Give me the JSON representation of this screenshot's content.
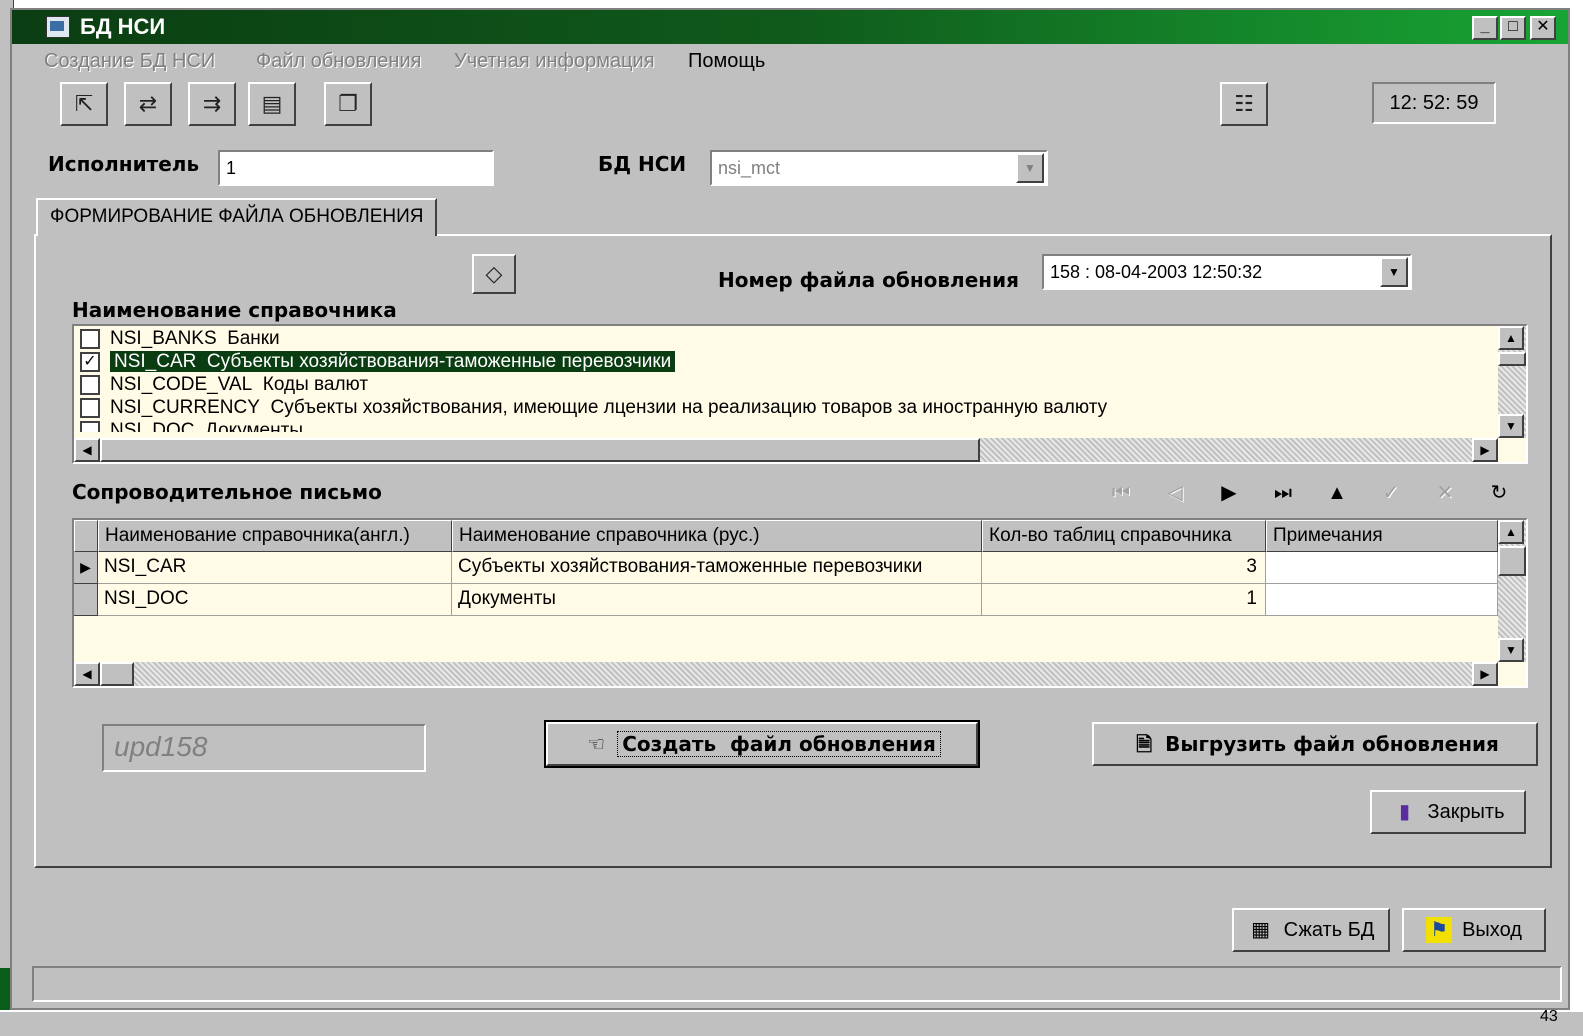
{
  "window": {
    "title": "БД НСИ",
    "caption_buttons": [
      "_",
      "□",
      "✕"
    ]
  },
  "menu": [
    "Создание БД НСИ",
    "Файл обновления",
    "Учетная информация",
    "Помощь"
  ],
  "toolbar": {
    "icons": [
      "export-icon",
      "transfer-icon",
      "merge-icon",
      "print-icon",
      "copy-icon",
      "tree-icon"
    ],
    "clock": "12: 52: 59"
  },
  "header": {
    "executor_label": "Исполнитель",
    "executor_value": "1",
    "db_label": "БД НСИ",
    "db_value": "nsi_mct"
  },
  "tab": {
    "label": "ФОРМИРОВАНИЕ ФАЙЛА ОБНОВЛЕНИЯ"
  },
  "update_file": {
    "label": "Номер файла обновления",
    "value": "158 : 08-04-2003 12:50:32"
  },
  "directory_list": {
    "label": "Наименование справочника",
    "items": [
      {
        "code": "NSI_BANKS",
        "name": "Банки",
        "checked": false,
        "selected": false
      },
      {
        "code": "NSI_CAR",
        "name": "Субъекты хозяйствования-таможенные перевозчики",
        "checked": true,
        "selected": true
      },
      {
        "code": "NSI_CODE_VAL",
        "name": "Коды валют",
        "checked": false,
        "selected": false
      },
      {
        "code": "NSI_CURRENCY",
        "name": "Субъекты хозяйствования, имеющие лцензии на реализацию товаров за иностранную валюту",
        "checked": false,
        "selected": false
      },
      {
        "code": "NSI_DOC",
        "name": "Документы",
        "checked": false,
        "selected": false
      }
    ]
  },
  "cover_letter": {
    "label": "Сопроводительное письмо",
    "columns": [
      "Наименование справочника(англ.)",
      "Наименование справочника (рус.)",
      "Кол-во таблиц справочника",
      "Примечания"
    ],
    "rows": [
      {
        "en": "NSI_CAR",
        "ru": "Субъекты хозяйствования-таможенные перевозчики",
        "count": "3",
        "note": "",
        "current": true
      },
      {
        "en": "NSI_DOC",
        "ru": "Документы",
        "count": "1",
        "note": "",
        "current": false
      }
    ]
  },
  "navigator": {
    "buttons": [
      {
        "name": "nav-first-button",
        "glyph": "⏮",
        "enabled": false
      },
      {
        "name": "nav-prior-button",
        "glyph": "◁",
        "enabled": false
      },
      {
        "name": "nav-next-button",
        "glyph": "▶",
        "enabled": true
      },
      {
        "name": "nav-last-button",
        "glyph": "⏭",
        "enabled": true
      },
      {
        "name": "nav-insert-button",
        "glyph": "▲",
        "enabled": true
      },
      {
        "name": "nav-post-button",
        "glyph": "✓",
        "enabled": false
      },
      {
        "name": "nav-cancel-button",
        "glyph": "✕",
        "enabled": false
      },
      {
        "name": "nav-refresh-button",
        "glyph": "↻",
        "enabled": true
      }
    ]
  },
  "actions": {
    "filename": "upd158",
    "create": "Создать  файл обновления",
    "export": "Выгрузить файл обновления",
    "close": "Закрыть",
    "compress": "Сжать БД",
    "exit": "Выход"
  },
  "background": {
    "taskbar_number": "43"
  }
}
